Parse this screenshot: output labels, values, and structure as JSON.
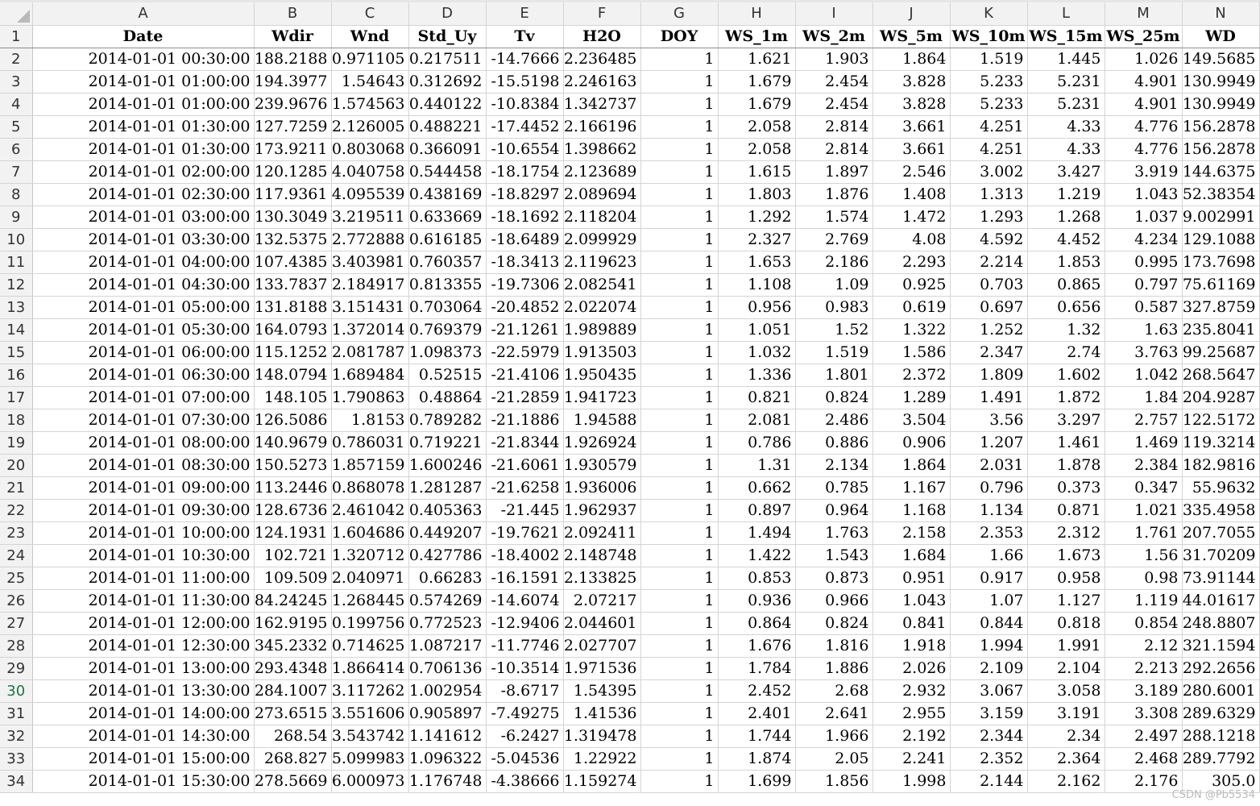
{
  "columns": [
    "A",
    "B",
    "C",
    "D",
    "E",
    "F",
    "G",
    "H",
    "I",
    "J",
    "K",
    "L",
    "M",
    "N"
  ],
  "headers": [
    "Date",
    "Wdir",
    "Wnd",
    "Std_Uy",
    "Tv",
    "H2O",
    "DOY",
    "WS_1m",
    "WS_2m",
    "WS_5m",
    "WS_10m",
    "WS_15m",
    "WS_25m",
    "WD"
  ],
  "active_row": 30,
  "rows": [
    {
      "n": "2",
      "c": [
        "2014-01-01 00:30:00",
        "188.2188",
        "0.971105",
        "0.217511",
        "-14.7666",
        "2.236485",
        "1",
        "1.621",
        "1.903",
        "1.864",
        "1.519",
        "1.445",
        "1.026",
        "149.5685"
      ]
    },
    {
      "n": "3",
      "c": [
        "2014-01-01 01:00:00",
        "194.3977",
        "1.54643",
        "0.312692",
        "-15.5198",
        "2.246163",
        "1",
        "1.679",
        "2.454",
        "3.828",
        "5.233",
        "5.231",
        "4.901",
        "130.9949"
      ]
    },
    {
      "n": "4",
      "c": [
        "2014-01-01 01:00:00",
        "239.9676",
        "1.574563",
        "0.440122",
        "-10.8384",
        "1.342737",
        "1",
        "1.679",
        "2.454",
        "3.828",
        "5.233",
        "5.231",
        "4.901",
        "130.9949"
      ]
    },
    {
      "n": "5",
      "c": [
        "2014-01-01 01:30:00",
        "127.7259",
        "2.126005",
        "0.488221",
        "-17.4452",
        "2.166196",
        "1",
        "2.058",
        "2.814",
        "3.661",
        "4.251",
        "4.33",
        "4.776",
        "156.2878"
      ]
    },
    {
      "n": "6",
      "c": [
        "2014-01-01 01:30:00",
        "173.9211",
        "0.803068",
        "0.366091",
        "-10.6554",
        "1.398662",
        "1",
        "2.058",
        "2.814",
        "3.661",
        "4.251",
        "4.33",
        "4.776",
        "156.2878"
      ]
    },
    {
      "n": "7",
      "c": [
        "2014-01-01 02:00:00",
        "120.1285",
        "4.040758",
        "0.544458",
        "-18.1754",
        "2.123689",
        "1",
        "1.615",
        "1.897",
        "2.546",
        "3.002",
        "3.427",
        "3.919",
        "144.6375"
      ]
    },
    {
      "n": "8",
      "c": [
        "2014-01-01 02:30:00",
        "117.9361",
        "4.095539",
        "0.438169",
        "-18.8297",
        "2.089694",
        "1",
        "1.803",
        "1.876",
        "1.408",
        "1.313",
        "1.219",
        "1.043",
        "52.38354"
      ]
    },
    {
      "n": "9",
      "c": [
        "2014-01-01 03:00:00",
        "130.3049",
        "3.219511",
        "0.633669",
        "-18.1692",
        "2.118204",
        "1",
        "1.292",
        "1.574",
        "1.472",
        "1.293",
        "1.268",
        "1.037",
        "9.002991"
      ]
    },
    {
      "n": "10",
      "c": [
        "2014-01-01 03:30:00",
        "132.5375",
        "2.772888",
        "0.616185",
        "-18.6489",
        "2.099929",
        "1",
        "2.327",
        "2.769",
        "4.08",
        "4.592",
        "4.452",
        "4.234",
        "129.1088"
      ]
    },
    {
      "n": "11",
      "c": [
        "2014-01-01 04:00:00",
        "107.4385",
        "3.403981",
        "0.760357",
        "-18.3413",
        "2.119623",
        "1",
        "1.653",
        "2.186",
        "2.293",
        "2.214",
        "1.853",
        "0.995",
        "173.7698"
      ]
    },
    {
      "n": "12",
      "c": [
        "2014-01-01 04:30:00",
        "133.7837",
        "2.184917",
        "0.813355",
        "-19.7306",
        "2.082541",
        "1",
        "1.108",
        "1.09",
        "0.925",
        "0.703",
        "0.865",
        "0.797",
        "75.61169"
      ]
    },
    {
      "n": "13",
      "c": [
        "2014-01-01 05:00:00",
        "131.8188",
        "3.151431",
        "0.703064",
        "-20.4852",
        "2.022074",
        "1",
        "0.956",
        "0.983",
        "0.619",
        "0.697",
        "0.656",
        "0.587",
        "327.8759"
      ]
    },
    {
      "n": "14",
      "c": [
        "2014-01-01 05:30:00",
        "164.0793",
        "1.372014",
        "0.769379",
        "-21.1261",
        "1.989889",
        "1",
        "1.051",
        "1.52",
        "1.322",
        "1.252",
        "1.32",
        "1.63",
        "235.8041"
      ]
    },
    {
      "n": "15",
      "c": [
        "2014-01-01 06:00:00",
        "115.1252",
        "2.081787",
        "1.098373",
        "-22.5979",
        "1.913503",
        "1",
        "1.032",
        "1.519",
        "1.586",
        "2.347",
        "2.74",
        "3.763",
        "99.25687"
      ]
    },
    {
      "n": "16",
      "c": [
        "2014-01-01 06:30:00",
        "148.0794",
        "1.689484",
        "0.52515",
        "-21.4106",
        "1.950435",
        "1",
        "1.336",
        "1.801",
        "2.372",
        "1.809",
        "1.602",
        "1.042",
        "268.5647"
      ]
    },
    {
      "n": "17",
      "c": [
        "2014-01-01 07:00:00",
        "148.105",
        "1.790863",
        "0.48864",
        "-21.2859",
        "1.941723",
        "1",
        "0.821",
        "0.824",
        "1.289",
        "1.491",
        "1.872",
        "1.84",
        "204.9287"
      ]
    },
    {
      "n": "18",
      "c": [
        "2014-01-01 07:30:00",
        "126.5086",
        "1.8153",
        "0.789282",
        "-21.1886",
        "1.94588",
        "1",
        "2.081",
        "2.486",
        "3.504",
        "3.56",
        "3.297",
        "2.757",
        "122.5172"
      ]
    },
    {
      "n": "19",
      "c": [
        "2014-01-01 08:00:00",
        "140.9679",
        "0.786031",
        "0.719221",
        "-21.8344",
        "1.926924",
        "1",
        "0.786",
        "0.886",
        "0.906",
        "1.207",
        "1.461",
        "1.469",
        "119.3214"
      ]
    },
    {
      "n": "20",
      "c": [
        "2014-01-01 08:30:00",
        "150.5273",
        "1.857159",
        "1.600246",
        "-21.6061",
        "1.930579",
        "1",
        "1.31",
        "2.134",
        "1.864",
        "2.031",
        "1.878",
        "2.384",
        "182.9816"
      ]
    },
    {
      "n": "21",
      "c": [
        "2014-01-01 09:00:00",
        "113.2446",
        "0.868078",
        "1.281287",
        "-21.6258",
        "1.936006",
        "1",
        "0.662",
        "0.785",
        "1.167",
        "0.796",
        "0.373",
        "0.347",
        "55.9632"
      ]
    },
    {
      "n": "22",
      "c": [
        "2014-01-01 09:30:00",
        "128.6736",
        "2.461042",
        "0.405363",
        "-21.445",
        "1.962937",
        "1",
        "0.897",
        "0.964",
        "1.168",
        "1.134",
        "0.871",
        "1.021",
        "335.4958"
      ]
    },
    {
      "n": "23",
      "c": [
        "2014-01-01 10:00:00",
        "124.1931",
        "1.604686",
        "0.449207",
        "-19.7621",
        "2.092411",
        "1",
        "1.494",
        "1.763",
        "2.158",
        "2.353",
        "2.312",
        "1.761",
        "207.7055"
      ]
    },
    {
      "n": "24",
      "c": [
        "2014-01-01 10:30:00",
        "102.721",
        "1.320712",
        "0.427786",
        "-18.4002",
        "2.148748",
        "1",
        "1.422",
        "1.543",
        "1.684",
        "1.66",
        "1.673",
        "1.56",
        "31.70209"
      ]
    },
    {
      "n": "25",
      "c": [
        "2014-01-01 11:00:00",
        "109.509",
        "2.040971",
        "0.66283",
        "-16.1591",
        "2.133825",
        "1",
        "0.853",
        "0.873",
        "0.951",
        "0.917",
        "0.958",
        "0.98",
        "73.91144"
      ]
    },
    {
      "n": "26",
      "c": [
        "2014-01-01 11:30:00",
        "84.24245",
        "1.268445",
        "0.574269",
        "-14.6074",
        "2.07217",
        "1",
        "0.936",
        "0.966",
        "1.043",
        "1.07",
        "1.127",
        "1.119",
        "44.01617"
      ]
    },
    {
      "n": "27",
      "c": [
        "2014-01-01 12:00:00",
        "162.9195",
        "0.199756",
        "0.772523",
        "-12.9406",
        "2.044601",
        "1",
        "0.864",
        "0.824",
        "0.841",
        "0.844",
        "0.818",
        "0.854",
        "248.8807"
      ]
    },
    {
      "n": "28",
      "c": [
        "2014-01-01 12:30:00",
        "345.2332",
        "0.714625",
        "1.087217",
        "-11.7746",
        "2.027707",
        "1",
        "1.676",
        "1.816",
        "1.918",
        "1.994",
        "1.991",
        "2.12",
        "321.1594"
      ]
    },
    {
      "n": "29",
      "c": [
        "2014-01-01 13:00:00",
        "293.4348",
        "1.866414",
        "0.706136",
        "-10.3514",
        "1.971536",
        "1",
        "1.784",
        "1.886",
        "2.026",
        "2.109",
        "2.104",
        "2.213",
        "292.2656"
      ]
    },
    {
      "n": "30",
      "c": [
        "2014-01-01 13:30:00",
        "284.1007",
        "3.117262",
        "1.002954",
        "-8.6717",
        "1.54395",
        "1",
        "2.452",
        "2.68",
        "2.932",
        "3.067",
        "3.058",
        "3.189",
        "280.6001"
      ]
    },
    {
      "n": "31",
      "c": [
        "2014-01-01 14:00:00",
        "273.6515",
        "3.551606",
        "0.905897",
        "-7.49275",
        "1.41536",
        "1",
        "2.401",
        "2.641",
        "2.955",
        "3.159",
        "3.191",
        "3.308",
        "289.6329"
      ]
    },
    {
      "n": "32",
      "c": [
        "2014-01-01 14:30:00",
        "268.54",
        "3.543742",
        "1.141612",
        "-6.2427",
        "1.319478",
        "1",
        "1.744",
        "1.966",
        "2.192",
        "2.344",
        "2.34",
        "2.497",
        "288.1218"
      ]
    },
    {
      "n": "33",
      "c": [
        "2014-01-01 15:00:00",
        "268.827",
        "5.099983",
        "1.096322",
        "-5.04536",
        "1.22922",
        "1",
        "1.874",
        "2.05",
        "2.241",
        "2.352",
        "2.364",
        "2.468",
        "289.7792"
      ]
    },
    {
      "n": "34",
      "c": [
        "2014-01-01 15:30:00",
        "278.5669",
        "6.000973",
        "1.176748",
        "-4.38666",
        "1.159274",
        "1",
        "1.699",
        "1.856",
        "1.998",
        "2.144",
        "2.162",
        "2.176",
        "305.0"
      ]
    }
  ],
  "watermark": "CSDN @Pb5534"
}
